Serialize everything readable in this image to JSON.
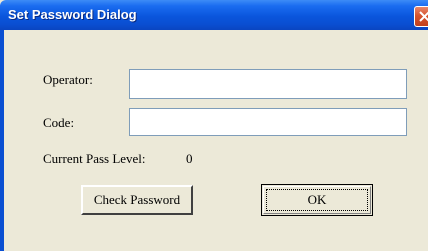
{
  "window": {
    "title": "Set Password Dialog",
    "close_icon": "close-icon"
  },
  "form": {
    "operator_label": "Operator:",
    "operator_value": "",
    "code_label": "Code:",
    "code_value": "",
    "pass_level_label": "Current Pass Level:",
    "pass_level_value": "0"
  },
  "buttons": {
    "check_password": "Check Password",
    "ok": "OK"
  },
  "colors": {
    "titlebar": "#0a55dc",
    "close_button": "#d6542e",
    "dialog_background": "#ece9d8"
  }
}
